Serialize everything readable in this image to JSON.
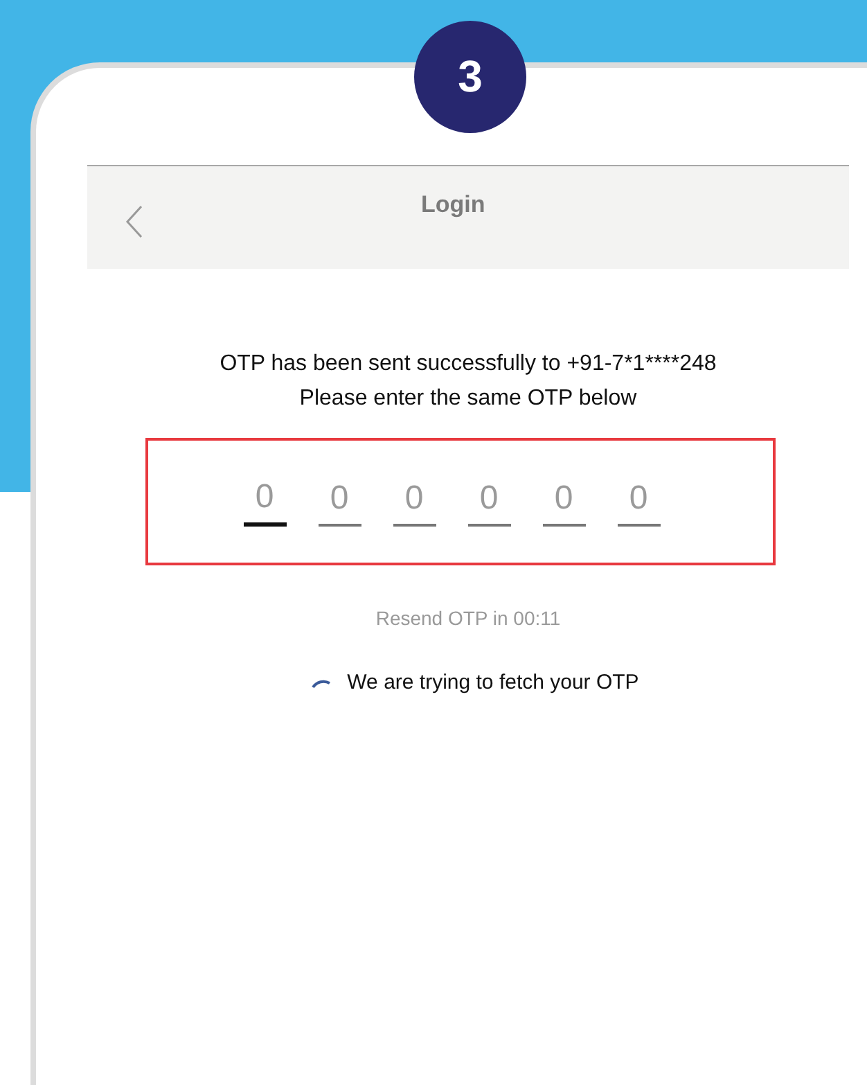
{
  "step_badge": "3",
  "header": {
    "title": "Login"
  },
  "message_lines": [
    "OTP has been sent successfully to +91-7*1****248",
    "Please enter the same OTP below"
  ],
  "otp_slots": [
    {
      "placeholder": "0",
      "selected": true
    },
    {
      "placeholder": "0",
      "selected": false
    },
    {
      "placeholder": "0",
      "selected": false
    },
    {
      "placeholder": "0",
      "selected": false
    },
    {
      "placeholder": "0",
      "selected": false
    },
    {
      "placeholder": "0",
      "selected": false
    }
  ],
  "resend_text": "Resend OTP in 00:11",
  "fetch_status": "We are trying to fetch your OTP"
}
